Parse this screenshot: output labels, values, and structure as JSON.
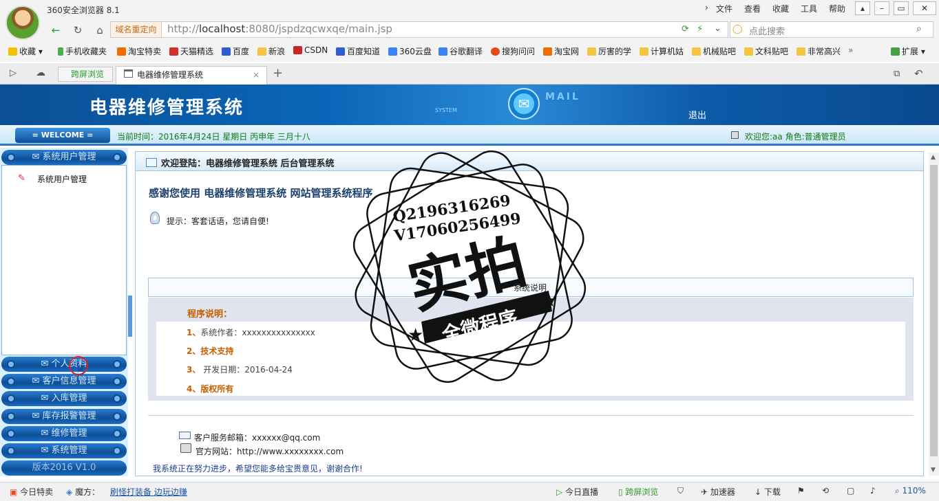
{
  "browser": {
    "app_title": "360安全浏览器 8.1",
    "menus": [
      "文件",
      "查看",
      "收藏",
      "工具",
      "帮助"
    ],
    "redirect_label": "域名重定向",
    "url_prefix": "http://",
    "url_host": "localhost",
    "url_rest": ":8080/jspdzqcwxqe/main.jsp",
    "search_placeholder": "点此搜索",
    "bookmarks": [
      "收藏",
      "手机收藏夹",
      "淘宝特卖",
      "天猫精选",
      "百度",
      "新浪",
      "CSDN",
      "百度知道",
      "360云盘",
      "谷歌翻译",
      "搜狗问问",
      "淘宝网",
      "厉害的学",
      "计算机姑",
      "机械贴吧",
      "文科贴吧",
      "非常高兴"
    ],
    "extensions_label": "扩展",
    "tab_split": "跨屏浏览",
    "tab_active": "电器维修管理系统"
  },
  "header": {
    "title": "电器维修管理系统",
    "system_word": "SYSTEM",
    "mail_word": "MAIL",
    "logout": "退出",
    "welcome_tag": "WELCOME",
    "datetime": "当前时间：2016年4月24日 星期日 丙申年 三月十八",
    "user_info": "欢迎您:aa 角色:普通管理员"
  },
  "sidebar": {
    "open_section": "系统用户管理",
    "open_link": "系统用户管理",
    "sections": [
      "个人资料",
      "客户信息管理",
      "入库管理",
      "库存报警管理",
      "维修管理",
      "系统管理"
    ],
    "version": "版本2016 V1.0"
  },
  "main": {
    "head": "欢迎登陆：电器维修管理系统 后台管理系统",
    "thanks": "感谢您使用 电器维修管理系统 网站管理系统程序",
    "tip": "提示：客套话语，您请自便!",
    "sys_desc_title": "系统说明",
    "desc_title": "程序说明：",
    "desc_1_num": "1、",
    "desc_1_text": "系统作者：xxxxxxxxxxxxxxx",
    "desc_2": "2、技术支持",
    "desc_3_num": "3、",
    "desc_3_text": "开发日期：2016-04-24",
    "desc_4": "4、版权所有",
    "email": "客户服务邮箱：xxxxxx@qq.com",
    "site": "官方网站：http://www.xxxxxxxx.com",
    "bottom_note": "我系统正在努力进步，希望您能多给宝贵意见，谢谢合作!"
  },
  "watermark": {
    "qq": "Q2196316269",
    "v": "V17060256499",
    "big": "实拍",
    "banner": "全微程序"
  },
  "statusbar": {
    "today_deals": "今日特卖",
    "cube": "魔方：",
    "promo": "刷怪打装备 边玩边赚",
    "live": "今日直播",
    "split": "跨屏浏览",
    "accelerator": "加速器",
    "download": "下载",
    "zoom": "110%"
  }
}
